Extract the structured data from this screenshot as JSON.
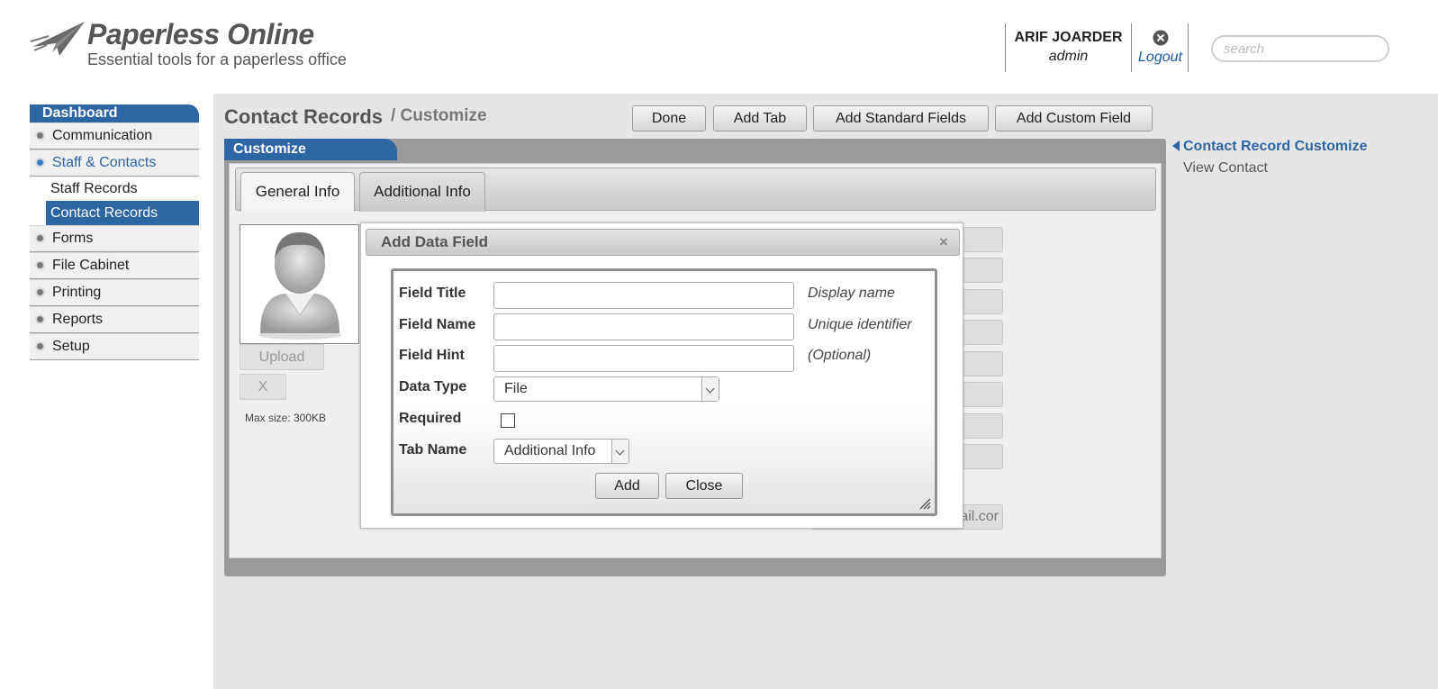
{
  "header": {
    "logo_title": "Paperless Online",
    "logo_tagline": "Essential tools for a paperless office",
    "user_name": "ARIF JOARDER",
    "user_role": "admin",
    "logout_label": "Logout",
    "search_placeholder": "search"
  },
  "sidebar": {
    "dashboard_label": "Dashboard",
    "items": [
      {
        "label": "Communication"
      },
      {
        "label": "Staff & Contacts"
      },
      {
        "label": "Forms"
      },
      {
        "label": "File Cabinet"
      },
      {
        "label": "Printing"
      },
      {
        "label": "Reports"
      },
      {
        "label": "Setup"
      }
    ],
    "sub_items": [
      {
        "label": "Staff Records"
      },
      {
        "label": "Contact Records"
      }
    ]
  },
  "main": {
    "title": "Contact Records",
    "subtitle": "/ Customize",
    "toolbar": {
      "done": "Done",
      "add_tab": "Add Tab",
      "add_standard": "Add Standard Fields",
      "add_custom": "Add Custom Field"
    },
    "panel_title": "Customize",
    "tabs": [
      {
        "label": "General Info"
      },
      {
        "label": "Additional Info"
      }
    ],
    "upload_label": "Upload",
    "remove_label": "X",
    "max_size": "Max size: 300KB",
    "email_fragment": "nail.cor"
  },
  "right_nav": {
    "active": "Contact Record Customize",
    "link": "View Contact"
  },
  "dialog": {
    "title": "Add Data Field",
    "close_symbol": "×",
    "fields": {
      "field_title_label": "Field Title",
      "field_title_hint": "Display name",
      "field_name_label": "Field Name",
      "field_name_hint": "Unique identifier",
      "field_hint_label": "Field Hint",
      "field_hint_hint": "(Optional)",
      "data_type_label": "Data Type",
      "data_type_value": "File",
      "required_label": "Required",
      "required_checked": false,
      "tab_name_label": "Tab Name",
      "tab_name_value": "Additional Info"
    },
    "add_button": "Add",
    "close_button": "Close"
  },
  "colors": {
    "accent_blue": "#2e65a3",
    "panel_gray": "#9a9a9a",
    "main_bg": "#e6e6e6"
  }
}
